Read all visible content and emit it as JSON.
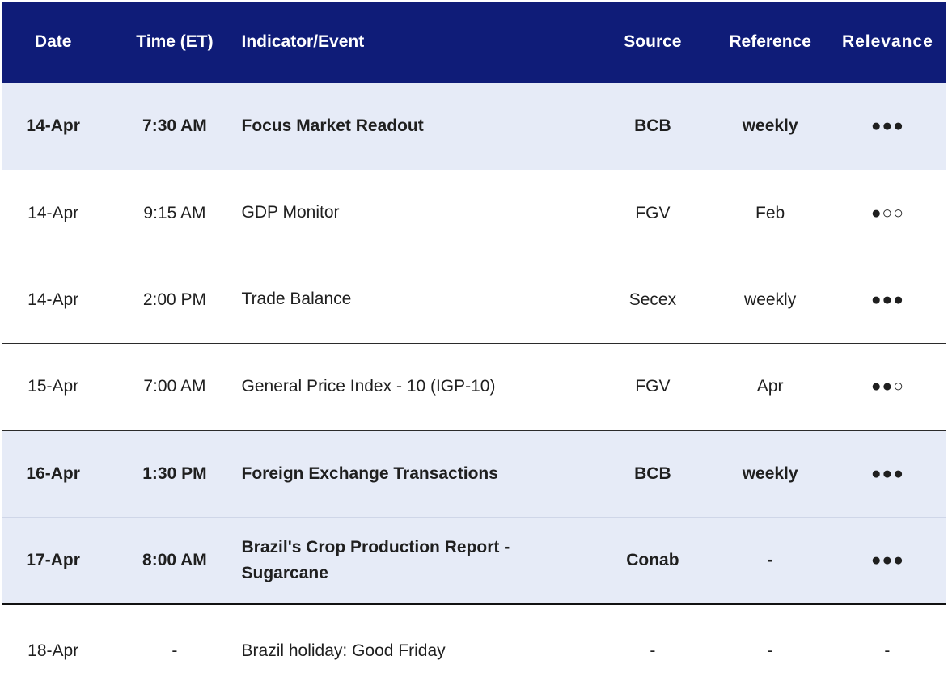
{
  "header": {
    "date": "Date",
    "time": "Time (ET)",
    "event": "Indicator/Event",
    "source": "Source",
    "reference": "Reference",
    "relevance": "Relevance"
  },
  "rows": [
    {
      "date": "14-Apr",
      "time": "7:30 AM",
      "event": "Focus Market Readout",
      "source": "BCB",
      "reference": "weekly",
      "relevance": "●●●"
    },
    {
      "date": "14-Apr",
      "time": "9:15 AM",
      "event": "GDP Monitor",
      "source": "FGV",
      "reference": "Feb",
      "relevance": "●○○"
    },
    {
      "date": "14-Apr",
      "time": "2:00 PM",
      "event": "Trade Balance",
      "source": "Secex",
      "reference": "weekly",
      "relevance": "●●●"
    },
    {
      "date": "15-Apr",
      "time": "7:00 AM",
      "event": "General Price Index - 10 (IGP-10)",
      "source": "FGV",
      "reference": "Apr",
      "relevance": "●●○"
    },
    {
      "date": "16-Apr",
      "time": "1:30 PM",
      "event": "Foreign Exchange Transactions",
      "source": "BCB",
      "reference": "weekly",
      "relevance": "●●●"
    },
    {
      "date": "17-Apr",
      "time": "8:00 AM",
      "event": "Brazil's Crop Production Report - Sugarcane",
      "source": "Conab",
      "reference": "-",
      "relevance": "●●●"
    },
    {
      "date": "18-Apr",
      "time": "-",
      "event": "Brazil holiday: Good Friday",
      "source": "-",
      "reference": "-",
      "relevance": "-"
    }
  ],
  "colors": {
    "header_bg": "#0f1c78",
    "highlight_bg": "#e6ebf7"
  }
}
